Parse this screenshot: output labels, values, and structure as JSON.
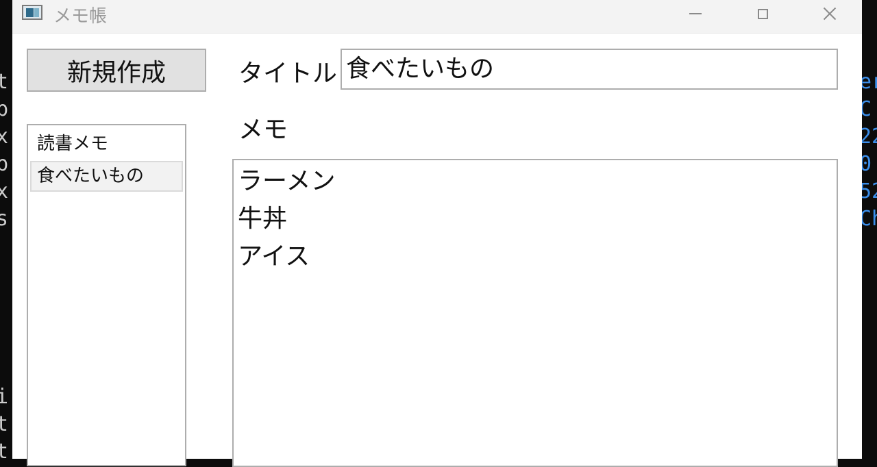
{
  "window": {
    "title": "メモ帳",
    "controls": {
      "minimize": "minimize-icon",
      "maximize": "maximize-icon",
      "close": "close-icon"
    }
  },
  "toolbar": {
    "new_label": "新規作成"
  },
  "memo_list": {
    "items": [
      {
        "label": "読書メモ",
        "selected": false
      },
      {
        "label": "食べたいもの",
        "selected": true
      }
    ]
  },
  "editor": {
    "title_label": "タイトル",
    "title_value": "食べたいもの",
    "memo_label": "メモ",
    "memo_lines": [
      "ラーメン",
      "牛丼",
      "アイス"
    ]
  },
  "background_terminal": {
    "left_chars": [
      "t",
      "b",
      "x",
      "b",
      "x",
      "s",
      "i",
      "t",
      "t"
    ],
    "right_chars": [
      "er",
      "C",
      "22",
      "0",
      "52",
      "Ch"
    ]
  },
  "colors": {
    "button_bg": "#e1e1e1",
    "border": "#adadad",
    "selected_item_bg": "#f2f2f2",
    "titlebar_bg": "#f3f3f3",
    "terminal_bg": "#0c0c0c"
  }
}
